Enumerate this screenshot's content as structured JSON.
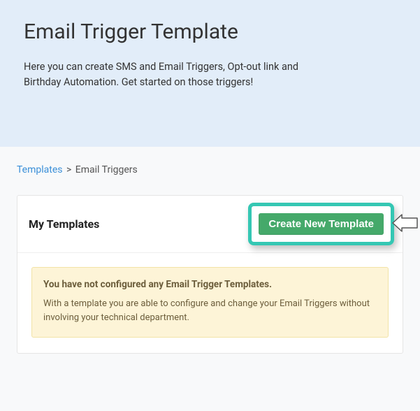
{
  "header": {
    "title": "Email Trigger Template",
    "subtitle": "Here you can create SMS and Email Triggers, Opt-out link and Birthday Automation. Get started on those triggers!"
  },
  "breadcrumb": {
    "link_label": "Templates",
    "separator": ">",
    "current": "Email Triggers"
  },
  "card": {
    "title": "My Templates",
    "create_button_label": "Create New Template"
  },
  "alert": {
    "title": "You have not configured any Email Trigger Templates.",
    "message": "With a template you are able to configure and change your Email Triggers without involving your technical department."
  },
  "colors": {
    "header_bg": "#e2edf9",
    "button_bg": "#45a96a",
    "highlight_border": "#34c7b3",
    "alert_bg": "#fdf4d7",
    "link": "#3a8fd8"
  }
}
